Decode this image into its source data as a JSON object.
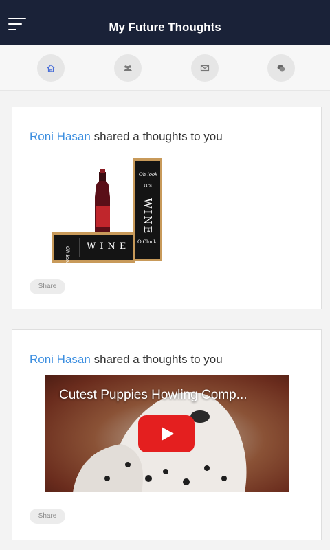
{
  "header": {
    "title": "My Future Thoughts",
    "menu_icon": "hamburger-menu-icon",
    "background": "#1a2238"
  },
  "nav": {
    "items": [
      {
        "icon": "home-icon",
        "name": "nav-home"
      },
      {
        "icon": "users-icon",
        "name": "nav-friends"
      },
      {
        "icon": "mail-icon",
        "name": "nav-messages"
      },
      {
        "icon": "chat-icon",
        "name": "nav-chat"
      }
    ]
  },
  "accent_color": "#3d8fe0",
  "feed": [
    {
      "sender": "Roni Hasan",
      "message": "shared a thoughts to you",
      "media": {
        "type": "image",
        "box_text_top": "Oh look",
        "box_text_mid": "IT'S",
        "box_text_word": "WINE",
        "box_text_bottom": "O'Clock"
      },
      "share_label": "Share"
    },
    {
      "sender": "Roni Hasan",
      "message": "shared a thoughts to you",
      "media": {
        "type": "video",
        "title": "Cutest Puppies Howling Comp..."
      },
      "share_label": "Share"
    }
  ]
}
